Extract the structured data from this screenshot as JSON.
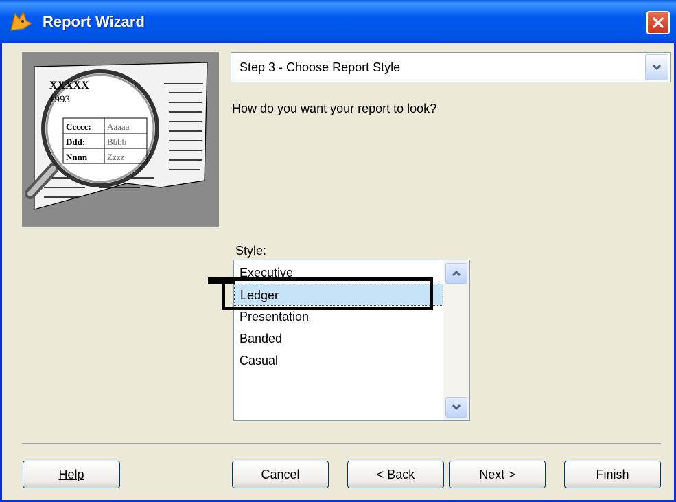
{
  "window": {
    "title": "Report Wizard",
    "title_icon": "fox-icon",
    "close_icon": "close-icon"
  },
  "picture": {
    "icon": "magnifier-report-icon",
    "heading": "XXXXX",
    "year": "1993",
    "rows": [
      {
        "label": "Ccccc:",
        "value": "Aaaaa"
      },
      {
        "label": "Ddd:",
        "value": "Bbbb"
      },
      {
        "label": "Nnnn",
        "value": "Zzzz"
      }
    ]
  },
  "step": {
    "selected": "Step 3 - Choose Report Style",
    "dropdown_icon": "chevron-down-icon"
  },
  "question": "How do you want your report to look?",
  "style": {
    "label": "Style:",
    "selected": "Ledger",
    "options": [
      "Executive",
      "Ledger",
      "Presentation",
      "Banded",
      "Casual"
    ]
  },
  "buttons": {
    "help": "Help",
    "cancel": "Cancel",
    "back": "< Back",
    "next": "Next >",
    "finish": "Finish"
  }
}
